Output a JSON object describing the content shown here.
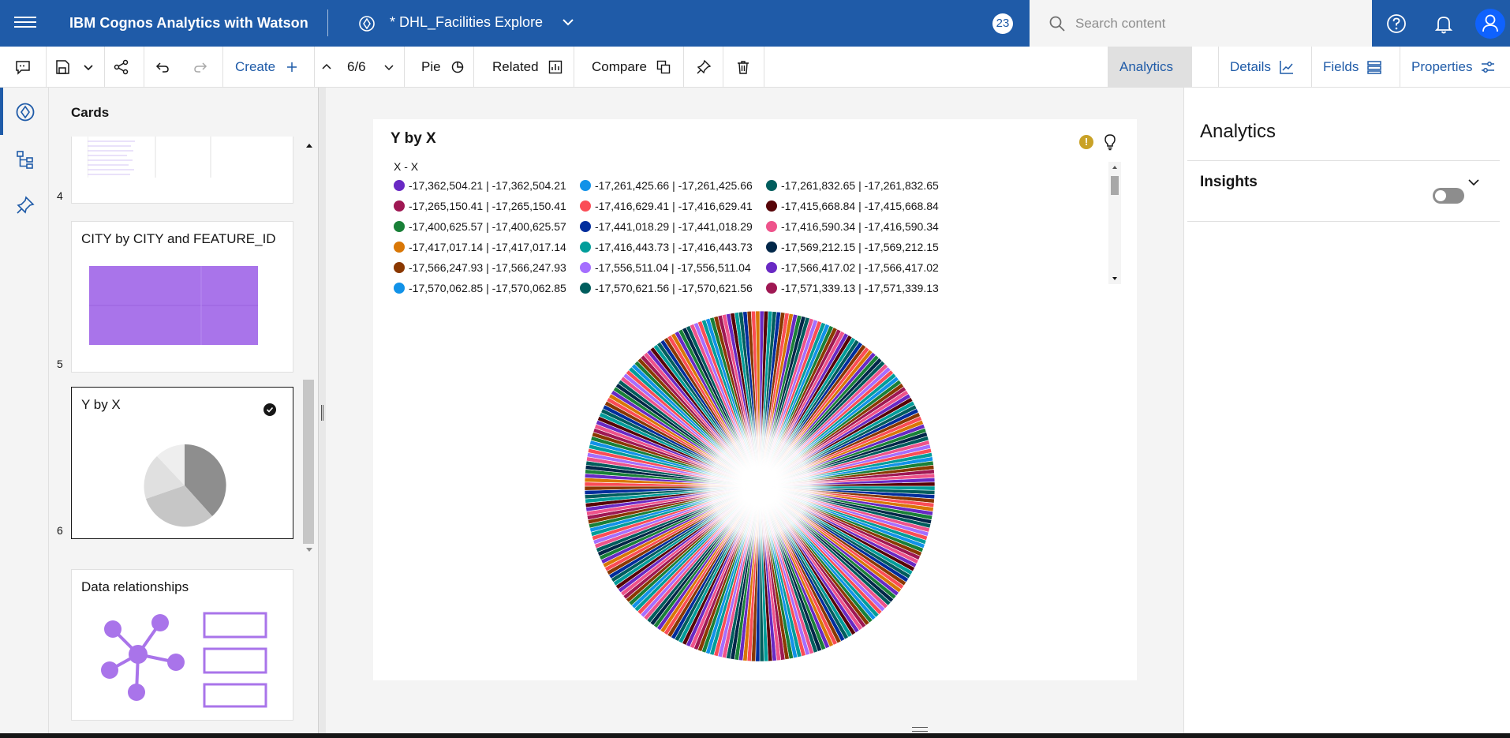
{
  "topbar": {
    "app_title": "IBM Cognos Analytics with Watson",
    "doc_title": "* DHL_Facilities Explore",
    "notification_count": "23",
    "search_placeholder": "Search content"
  },
  "toolbar": {
    "create_label": "Create",
    "page_indicator": "6/6",
    "pie_label": "Pie",
    "related_label": "Related",
    "compare_label": "Compare",
    "tabs": [
      {
        "label": "Analytics",
        "active": true
      },
      {
        "label": "Details",
        "active": false
      },
      {
        "label": "Fields",
        "active": false
      },
      {
        "label": "Properties",
        "active": false
      }
    ]
  },
  "cards_panel": {
    "heading": "Cards",
    "cards": [
      {
        "number": "4",
        "title": ""
      },
      {
        "number": "5",
        "title": "CITY by CITY and FEATURE_ID"
      },
      {
        "number": "6",
        "title": "Y by X",
        "selected": true
      },
      {
        "number": "",
        "title": "Data relationships"
      }
    ]
  },
  "viz": {
    "title": "Y by X",
    "legend_title": "X - X",
    "legend": [
      {
        "label": "-17,362,504.21 | -17,362,504.21",
        "color": "#6929c4"
      },
      {
        "label": "-17,261,425.66 | -17,261,425.66",
        "color": "#1192e8"
      },
      {
        "label": "-17,261,832.65 | -17,261,832.65",
        "color": "#005d5d"
      },
      {
        "label": "-17,265,150.41 | -17,265,150.41",
        "color": "#9f1853"
      },
      {
        "label": "-17,416,629.41 | -17,416,629.41",
        "color": "#fa4d56"
      },
      {
        "label": "-17,415,668.84 | -17,415,668.84",
        "color": "#570408"
      },
      {
        "label": "-17,400,625.57 | -17,400,625.57",
        "color": "#198038"
      },
      {
        "label": "-17,441,018.29 | -17,441,018.29",
        "color": "#002d9c"
      },
      {
        "label": "-17,416,590.34 | -17,416,590.34",
        "color": "#ee538b"
      },
      {
        "label": "-17,417,017.14 | -17,417,017.14",
        "color": "#d97706"
      },
      {
        "label": "-17,416,443.73 | -17,416,443.73",
        "color": "#009d9a"
      },
      {
        "label": "-17,569,212.15 | -17,569,212.15",
        "color": "#012749"
      },
      {
        "label": "-17,566,247.93 | -17,566,247.93",
        "color": "#8a3800"
      },
      {
        "label": "-17,556,511.04 | -17,556,511.04",
        "color": "#a56eff"
      },
      {
        "label": "-17,566,417.02 | -17,566,417.02",
        "color": "#6929c4"
      },
      {
        "label": "-17,570,062.85 | -17,570,062.85",
        "color": "#1192e8"
      },
      {
        "label": "-17,570,621.56 | -17,570,621.56",
        "color": "#005d5d"
      },
      {
        "label": "-17,571,339.13 | -17,571,339.13",
        "color": "#9f1853"
      }
    ],
    "palette": [
      "#6929c4",
      "#1192e8",
      "#005d5d",
      "#9f1853",
      "#fa4d56",
      "#570408",
      "#198038",
      "#002d9c",
      "#ee538b",
      "#d97706",
      "#009d9a",
      "#012749",
      "#8a3800",
      "#a56eff"
    ]
  },
  "right_panel": {
    "title": "Analytics",
    "insights_label": "Insights",
    "insights_enabled": false
  }
}
